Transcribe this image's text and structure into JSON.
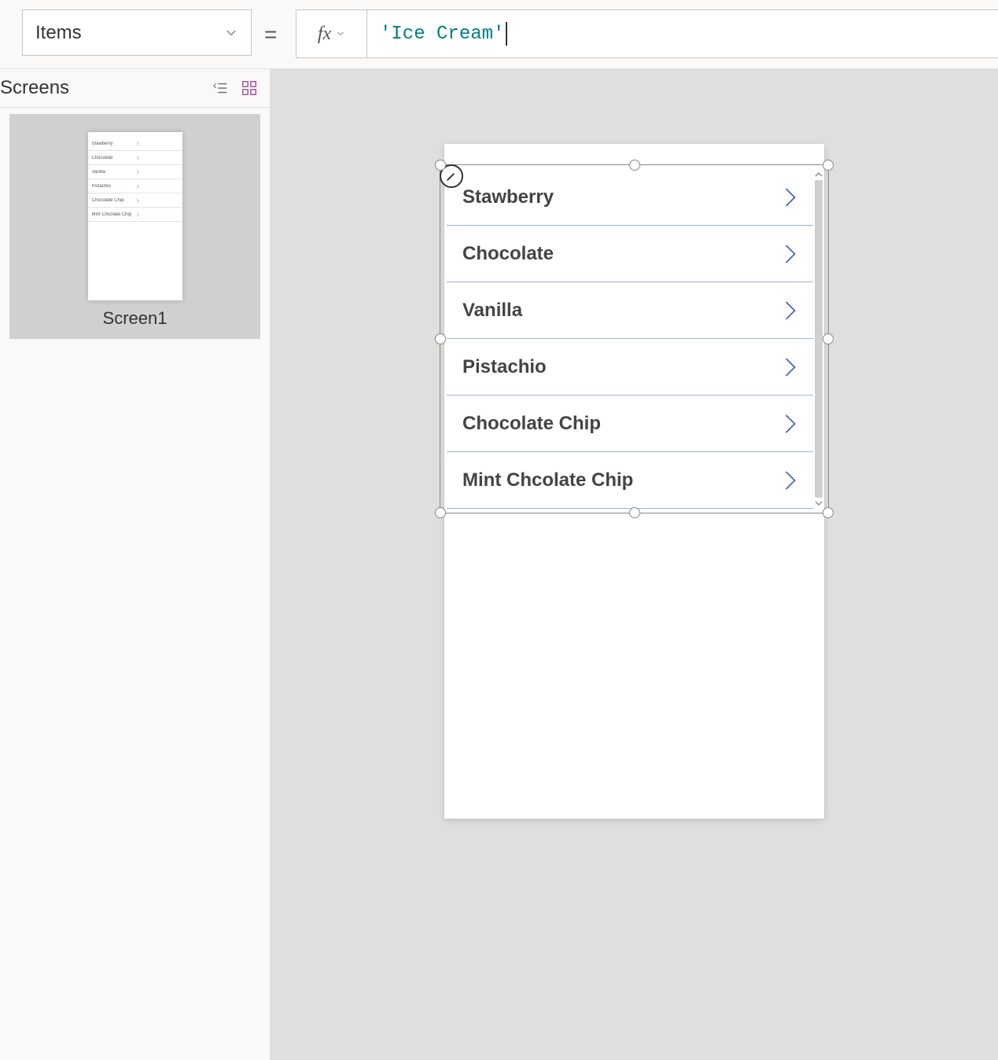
{
  "property_dropdown": {
    "selected": "Items"
  },
  "equals": "=",
  "formula_bar": {
    "fx_label": "fx",
    "value": "'Ice Cream'"
  },
  "screens_panel": {
    "title": "Screens",
    "thumbnail_label": "Screen1",
    "thumbnail_rows": [
      "Stawberry",
      "Chocolate",
      "Vanilla",
      "Pistachio",
      "Chocolate Chip",
      "Mint Chcolate Chip"
    ]
  },
  "gallery": {
    "items": [
      "Stawberry",
      "Chocolate",
      "Vanilla",
      "Pistachio",
      "Chocolate Chip",
      "Mint Chcolate Chip"
    ]
  }
}
